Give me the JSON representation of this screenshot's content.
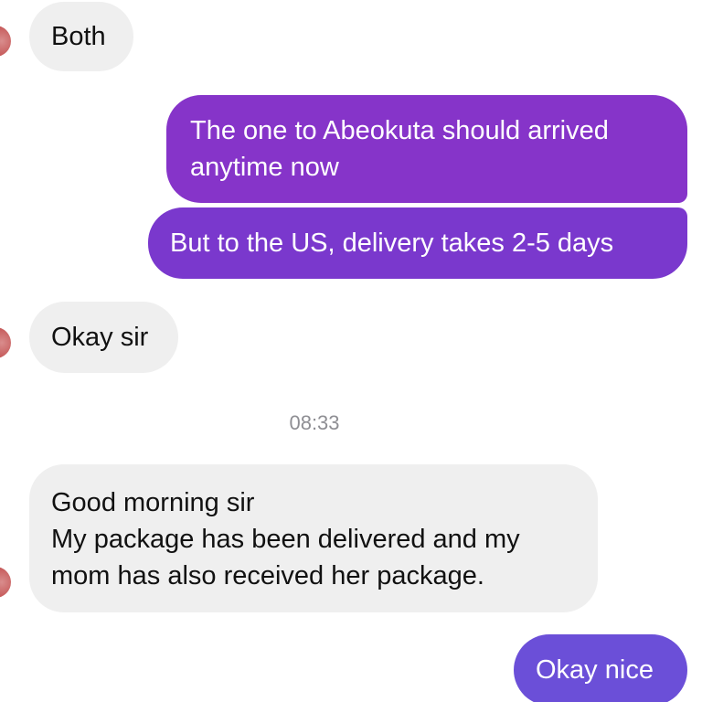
{
  "conversation": {
    "messages": [
      {
        "direction": "incoming",
        "text": "Both"
      },
      {
        "direction": "outgoing",
        "text": "The one to Abeokuta should arrived\nanytime now"
      },
      {
        "direction": "outgoing",
        "text": "But to the US, delivery takes 2-5 days"
      },
      {
        "direction": "incoming",
        "text": "Okay sir"
      },
      {
        "direction": "incoming",
        "text": "Good morning sir\nMy package has been delivered and my\nmom has also received her package."
      },
      {
        "direction": "outgoing",
        "text": "Okay nice"
      }
    ],
    "timestamp": "08:33"
  },
  "colors": {
    "incoming_bubble": "#efefef",
    "outgoing_gradient_top": "#8a34c8",
    "outgoing_gradient_bottom": "#6b3fd6"
  }
}
